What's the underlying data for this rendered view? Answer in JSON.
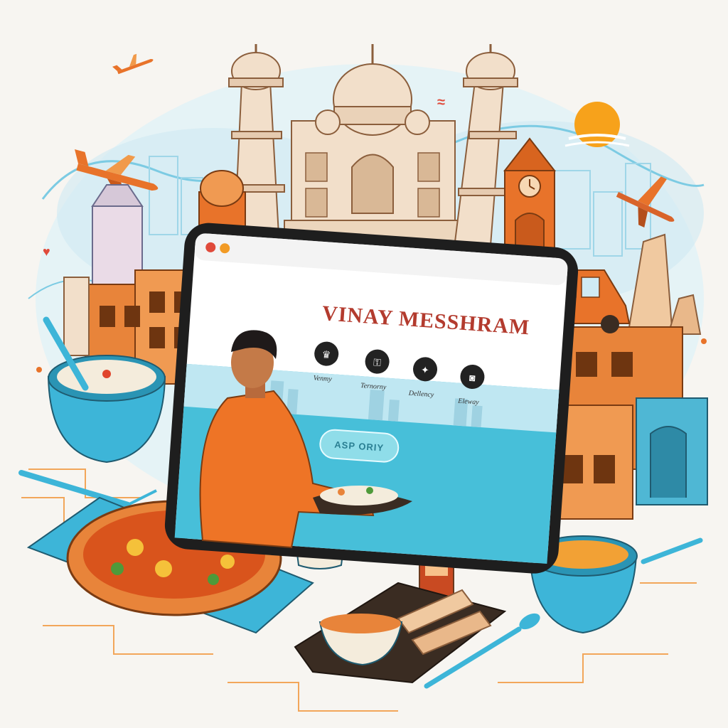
{
  "colors": {
    "background": "#f7f5f1",
    "accent_orange": "#e8732a",
    "accent_blue": "#3db5d8",
    "monument_stone": "#f0d9c2",
    "headline_red": "#b33b2e",
    "sun": "#f7a21b"
  },
  "tablet": {
    "browser_dots": [
      "#e04a3a",
      "#f29b25"
    ],
    "headline": "VINAY MESSHRAM",
    "nav_items": [
      {
        "icon": "crown-icon",
        "label": "Venmy"
      },
      {
        "icon": "lock-icon",
        "label": "Ternorny"
      },
      {
        "icon": "compass-icon",
        "label": "Dellency"
      },
      {
        "icon": "camera-icon",
        "label": "Eleway"
      }
    ],
    "cta_label": "ASP ORIY"
  }
}
